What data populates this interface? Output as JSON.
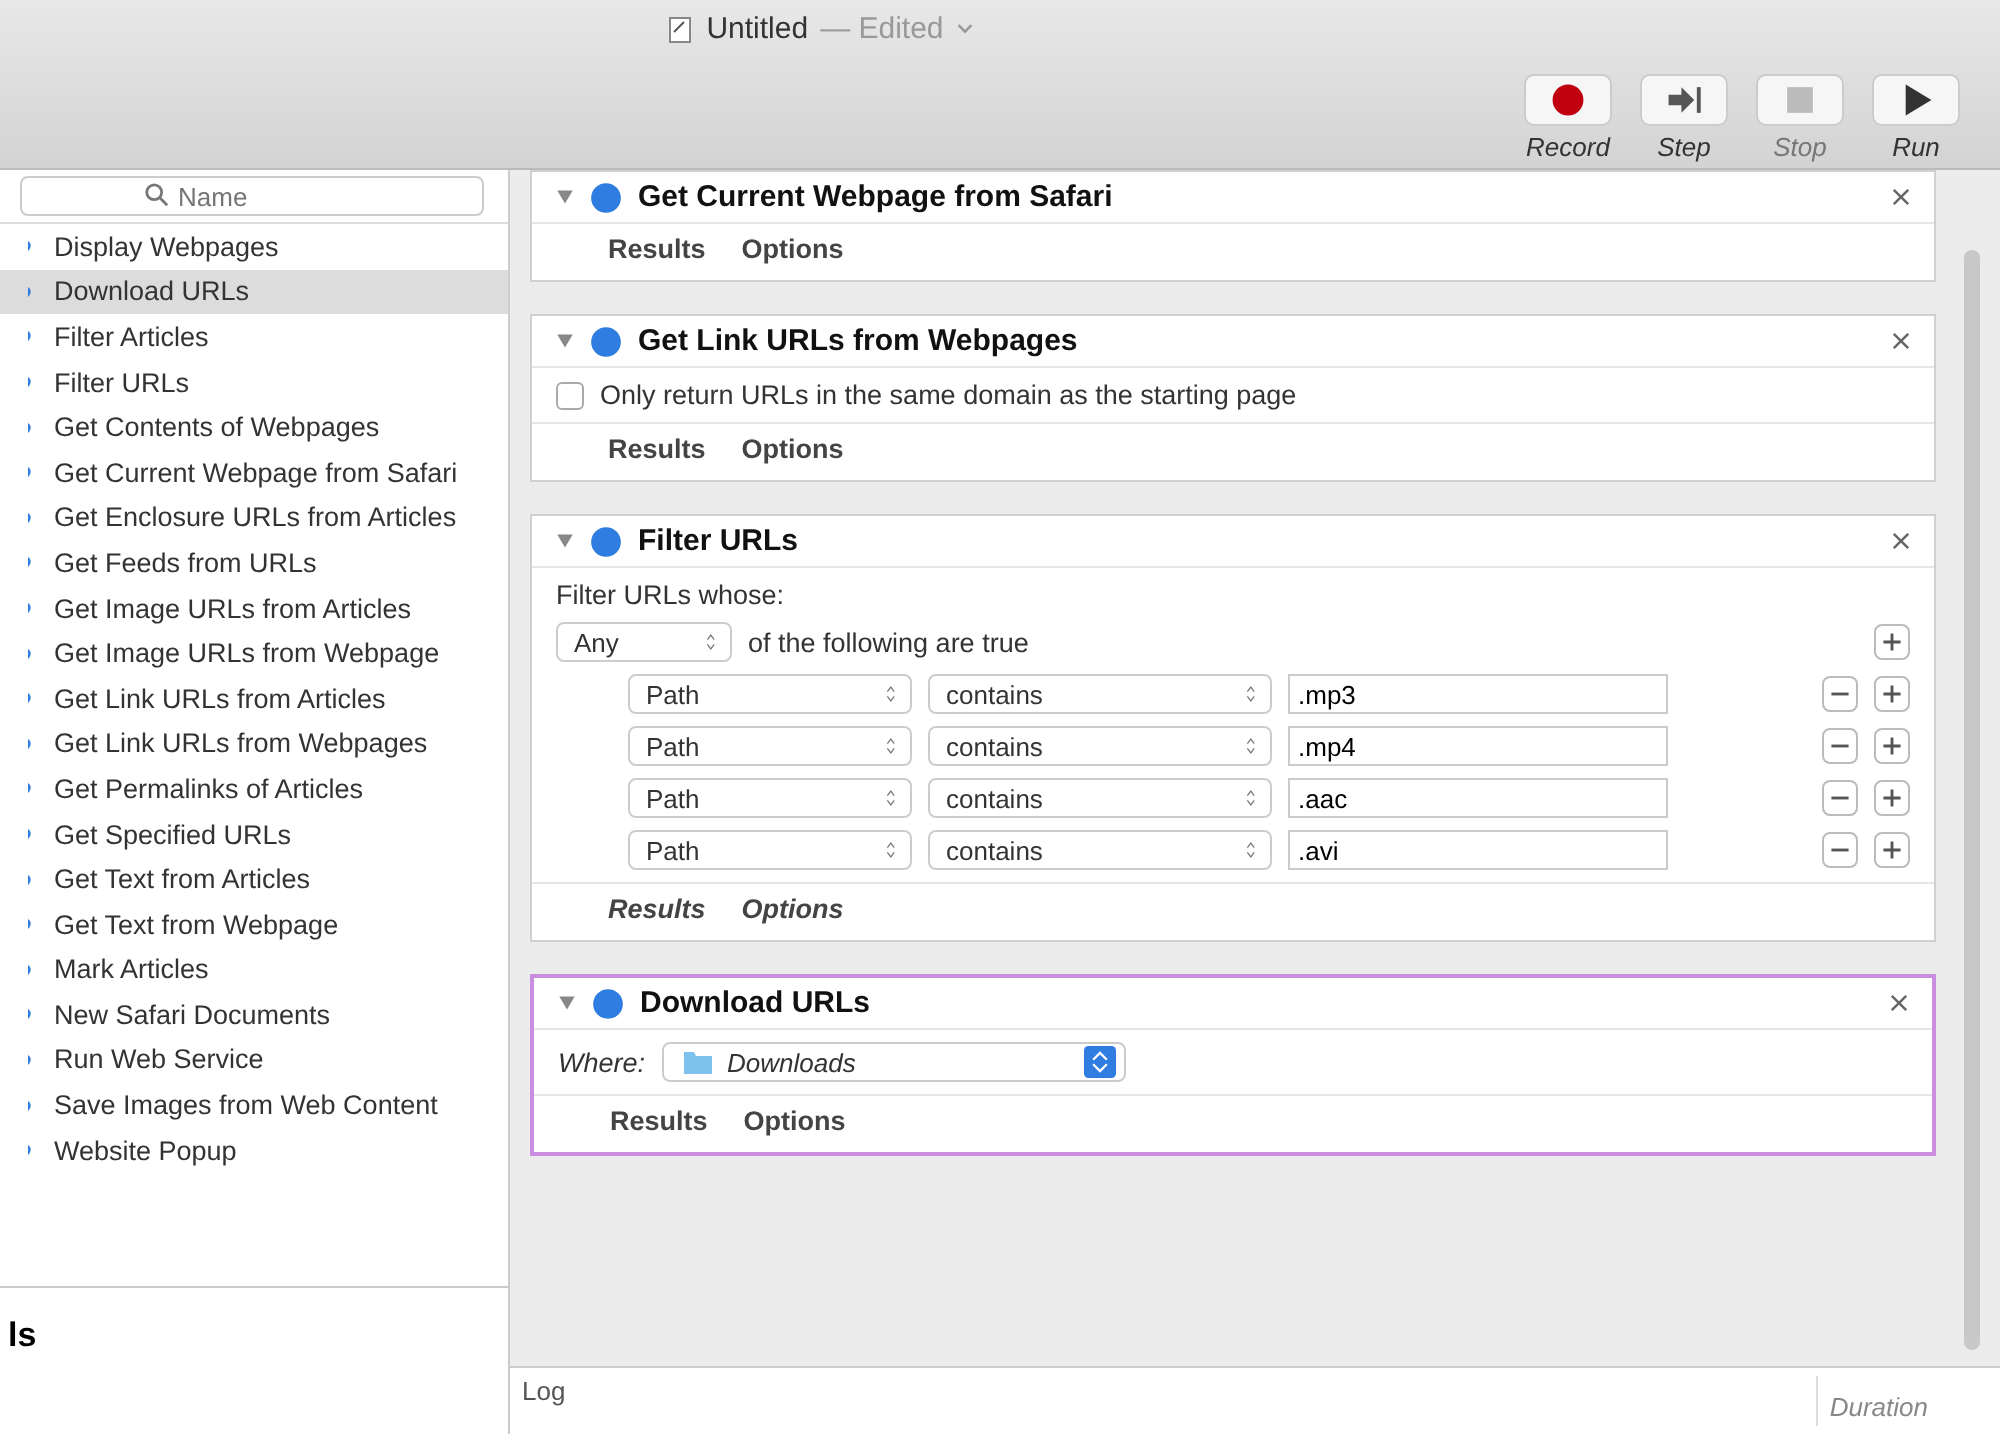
{
  "window": {
    "title": "Untitled",
    "status": "— Edited"
  },
  "toolbar": [
    {
      "label": "Record",
      "kind": "record",
      "disabled": false
    },
    {
      "label": "Step",
      "kind": "step",
      "disabled": false
    },
    {
      "label": "Stop",
      "kind": "stop",
      "disabled": true
    },
    {
      "label": "Run",
      "kind": "run",
      "disabled": false
    }
  ],
  "library": {
    "search": {
      "placeholder": "Name"
    },
    "items": [
      {
        "label": "Display Webpages",
        "selected": false
      },
      {
        "label": "Download URLs",
        "selected": true
      },
      {
        "label": "Filter Articles",
        "selected": false
      },
      {
        "label": "Filter URLs",
        "selected": false
      },
      {
        "label": "Get Contents of Webpages",
        "selected": false
      },
      {
        "label": "Get Current Webpage from Safari",
        "selected": false
      },
      {
        "label": "Get Enclosure URLs from Articles",
        "selected": false
      },
      {
        "label": "Get Feeds from URLs",
        "selected": false
      },
      {
        "label": "Get Image URLs from Articles",
        "selected": false
      },
      {
        "label": "Get Image URLs from Webpage",
        "selected": false
      },
      {
        "label": "Get Link URLs from Articles",
        "selected": false
      },
      {
        "label": "Get Link URLs from Webpages",
        "selected": false
      },
      {
        "label": "Get Permalinks of Articles",
        "selected": false
      },
      {
        "label": "Get Specified URLs",
        "selected": false
      },
      {
        "label": "Get Text from Articles",
        "selected": false
      },
      {
        "label": "Get Text from Webpage",
        "selected": false
      },
      {
        "label": "Mark Articles",
        "selected": false
      },
      {
        "label": "New Safari Documents",
        "selected": false
      },
      {
        "label": "Run Web Service",
        "selected": false
      },
      {
        "label": "Save Images from Web Content",
        "selected": false
      },
      {
        "label": "Website Popup",
        "selected": false
      }
    ],
    "footer_heading": "ls"
  },
  "workflow": {
    "actions": [
      {
        "title": "Get Current Webpage from Safari",
        "kind": "plain",
        "selected": false,
        "tabs": [
          "Results",
          "Options"
        ]
      },
      {
        "title": "Get Link URLs from Webpages",
        "kind": "checkbox",
        "selected": false,
        "option": {
          "label": "Only return URLs in the same domain as the starting page",
          "checked": false
        },
        "tabs": [
          "Results",
          "Options"
        ]
      },
      {
        "title": "Filter URLs",
        "kind": "filter",
        "selected": false,
        "intro": "Filter URLs whose:",
        "match": "Any",
        "match_suffix": "of the following are true",
        "rules": [
          {
            "field": "Path",
            "operator": "contains",
            "value": ".mp3"
          },
          {
            "field": "Path",
            "operator": "contains",
            "value": ".mp4"
          },
          {
            "field": "Path",
            "operator": "contains",
            "value": ".aac"
          },
          {
            "field": "Path",
            "operator": "contains",
            "value": ".avi"
          }
        ],
        "tabs": [
          "Results",
          "Options"
        ]
      },
      {
        "title": "Download URLs",
        "kind": "where",
        "selected": true,
        "where_label": "Where:",
        "where_value": "Downloads",
        "tabs": [
          "Results",
          "Options"
        ]
      }
    ]
  },
  "log": {
    "label": "Log",
    "column": "Duration"
  }
}
